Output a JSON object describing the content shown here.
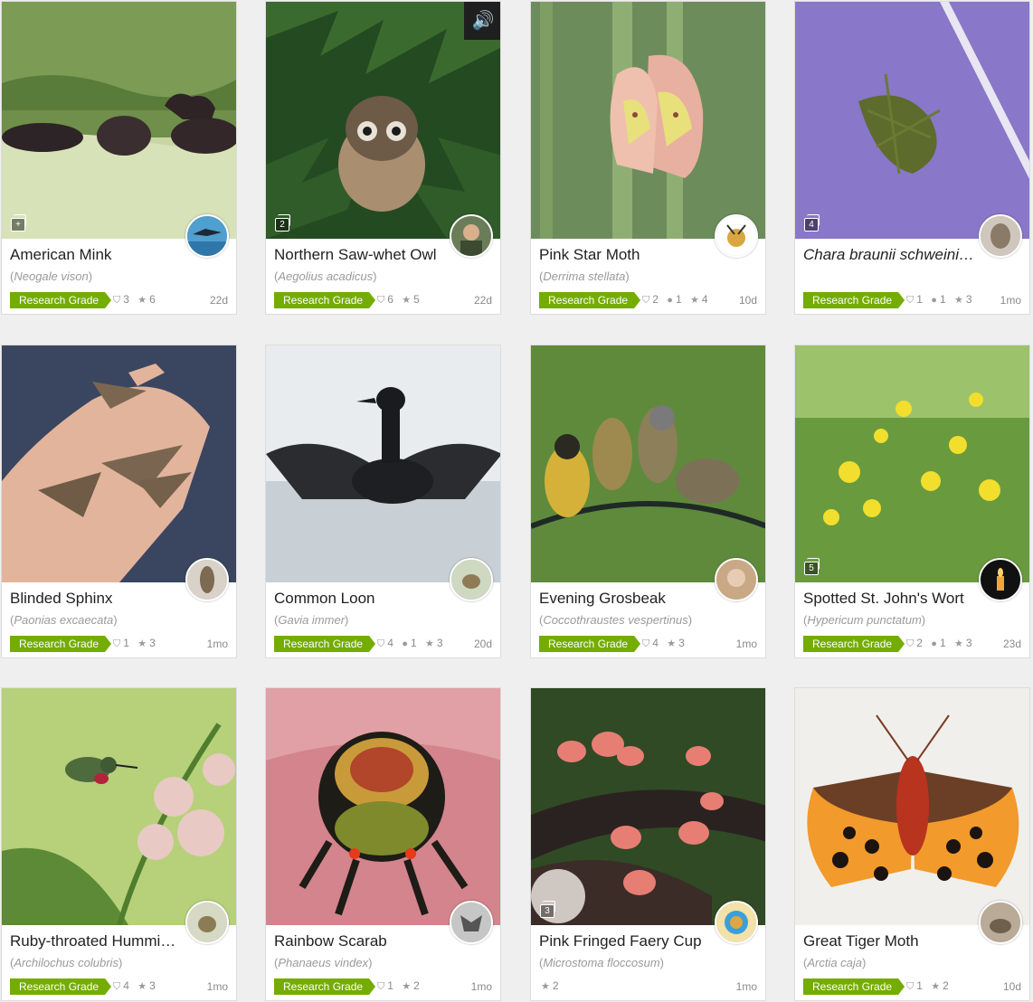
{
  "cards": [
    {
      "common": "American Mink",
      "scientific": "Neogale vison",
      "grade": "Research Grade",
      "ids": "3",
      "comments": null,
      "faves": "6",
      "age": "22d",
      "photos": "+",
      "sound": false
    },
    {
      "common": "Northern Saw-whet Owl",
      "scientific": "Aegolius acadicus",
      "grade": "Research Grade",
      "ids": "6",
      "comments": null,
      "faves": "5",
      "age": "22d",
      "photos": "2",
      "sound": true
    },
    {
      "common": "Pink Star Moth",
      "scientific": "Derrima stellata",
      "grade": "Research Grade",
      "ids": "2",
      "comments": "1",
      "faves": "4",
      "age": "10d",
      "photos": null,
      "sound": false
    },
    {
      "common": "Chara braunii schweinit…",
      "scientific": "",
      "grade": "Research Grade",
      "ids": "1",
      "comments": "1",
      "faves": "3",
      "age": "1mo",
      "photos": "4",
      "sound": false
    },
    {
      "common": "Blinded Sphinx",
      "scientific": "Paonias excaecata",
      "grade": "Research Grade",
      "ids": "1",
      "comments": null,
      "faves": "3",
      "age": "1mo",
      "photos": null,
      "sound": false
    },
    {
      "common": "Common Loon",
      "scientific": "Gavia immer",
      "grade": "Research Grade",
      "ids": "4",
      "comments": "1",
      "faves": "3",
      "age": "20d",
      "photos": null,
      "sound": false
    },
    {
      "common": "Evening Grosbeak",
      "scientific": "Coccothraustes vespertinus",
      "grade": "Research Grade",
      "ids": "4",
      "comments": null,
      "faves": "3",
      "age": "1mo",
      "photos": null,
      "sound": false
    },
    {
      "common": "Spotted St. John's Wort",
      "scientific": "Hypericum punctatum",
      "grade": "Research Grade",
      "ids": "2",
      "comments": "1",
      "faves": "3",
      "age": "23d",
      "photos": "5",
      "sound": false
    },
    {
      "common": "Ruby-throated Hummin…",
      "scientific": "Archilochus colubris",
      "grade": "Research Grade",
      "ids": "4",
      "comments": null,
      "faves": "3",
      "age": "1mo",
      "photos": null,
      "sound": false
    },
    {
      "common": "Rainbow Scarab",
      "scientific": "Phanaeus vindex",
      "grade": "Research Grade",
      "ids": "1",
      "comments": null,
      "faves": "2",
      "age": "1mo",
      "photos": null,
      "sound": false
    },
    {
      "common": "Pink Fringed Faery Cup",
      "scientific": "Microstoma floccosum",
      "grade": "",
      "ids": null,
      "comments": null,
      "faves": "2",
      "age": "1mo",
      "photos": "3",
      "sound": false
    },
    {
      "common": "Great Tiger Moth",
      "scientific": "Arctia caja",
      "grade": "Research Grade",
      "ids": "1",
      "comments": null,
      "faves": "2",
      "age": "10d",
      "photos": null,
      "sound": false
    }
  ],
  "icons": {
    "id": "shield-icon",
    "comment": "speech-bubble-icon",
    "fave": "star-icon",
    "sound": "speaker-icon",
    "photos": "photo-stack-icon"
  },
  "colors": {
    "research_grade": "#74ac00"
  }
}
